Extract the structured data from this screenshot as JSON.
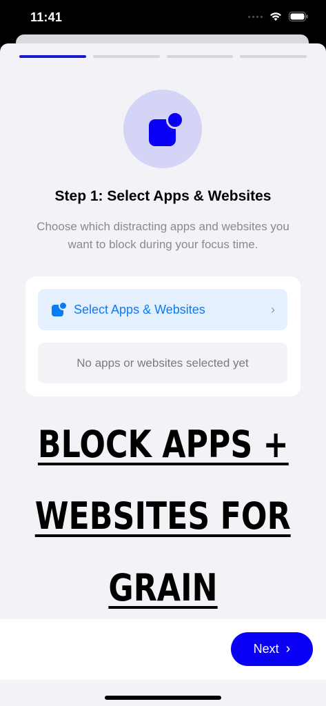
{
  "status_bar": {
    "time": "11:41"
  },
  "progress": {
    "total_steps": 4,
    "current_step": 1
  },
  "header": {
    "title": "Step 1: Select Apps & Websites",
    "subtitle": "Choose which distracting apps and websites you want to block during your focus time."
  },
  "card": {
    "select_label": "Select Apps & Websites",
    "empty_text": "No apps or websites selected yet"
  },
  "overlay": {
    "lines": [
      "BLOCK APPS +",
      "WEBSITES FOR",
      "GRAIN"
    ]
  },
  "footer": {
    "next_label": "Next"
  },
  "colors": {
    "accent": "#0a00f5",
    "link": "#0a7af5",
    "background": "#f2f2f7"
  },
  "icons": [
    "signal-icon",
    "wifi-icon",
    "battery-icon",
    "app-badge-icon",
    "chevron-right-icon"
  ]
}
